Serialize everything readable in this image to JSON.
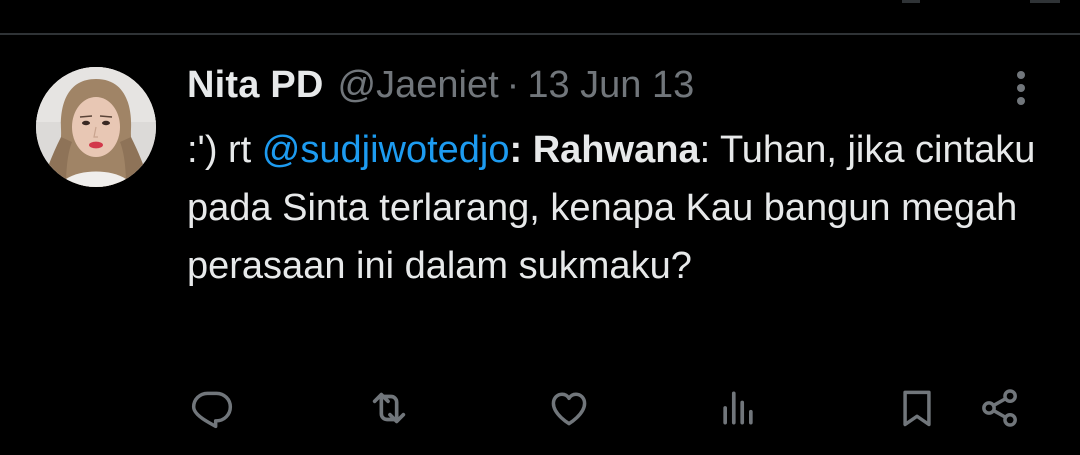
{
  "tweet": {
    "display_name": "Nita PD",
    "handle": "@Jaeniet",
    "separator": "·",
    "date": "13 Jun 13",
    "text": {
      "prefix": ":') rt ",
      "mention": "@sudjiwotedjo",
      "colon": ": ",
      "bold_word": "Rahwana",
      "rest": ": Tuhan, jika cintaku pada Sinta terlarang, kenapa Kau bangun megah perasaan ini dalam sukmaku?"
    }
  },
  "actions": {
    "reply": "reply-icon",
    "retweet": "retweet-icon",
    "like": "heart-icon",
    "views": "views-icon",
    "bookmark": "bookmark-icon",
    "share": "share-icon"
  },
  "colors": {
    "background": "#000000",
    "text": "#e7e9ea",
    "secondary_text": "#71767b",
    "link": "#1d9bf0",
    "divider": "#2f3336"
  }
}
